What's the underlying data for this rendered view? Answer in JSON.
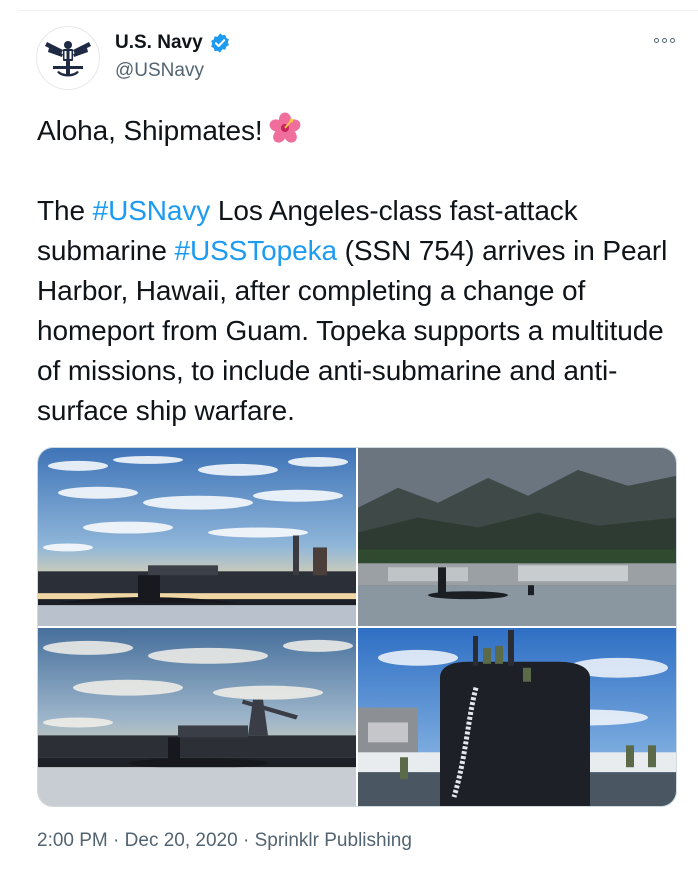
{
  "account": {
    "display_name": "U.S. Navy",
    "handle": "@USNavy",
    "verified": true,
    "avatar_icon": "navy-eagle-emblem-icon"
  },
  "menu": {
    "icon": "more-options-icon"
  },
  "tweet": {
    "line1": "Aloha, Shipmates!",
    "emoji_icon": "hibiscus-flower-icon",
    "p2_part1": "The ",
    "hashtag1": "#USNavy",
    "p2_part2": " Los Angeles-class fast-attack submarine ",
    "hashtag2": "#USSTopeka",
    "p2_part3": " (SSN 754) arrives in Pearl Harbor, Hawaii, after completing a change of homeport from Guam. Topeka supports a multitude of missions, to include anti-submarine and anti-surface ship warfare."
  },
  "media": {
    "photos": [
      {
        "icon": "submarine-harbor-dawn-photo"
      },
      {
        "icon": "submarine-mountains-photo"
      },
      {
        "icon": "submarine-cranes-photo"
      },
      {
        "icon": "submarine-sail-crew-photo"
      }
    ]
  },
  "footer": {
    "time": "2:00 PM",
    "sep1": " · ",
    "date": "Dec 20, 2020",
    "sep2": " · ",
    "source": "Sprinklr Publishing"
  },
  "colors": {
    "accent": "#1d9bf0",
    "text": "#0f1419",
    "muted": "#536471"
  }
}
